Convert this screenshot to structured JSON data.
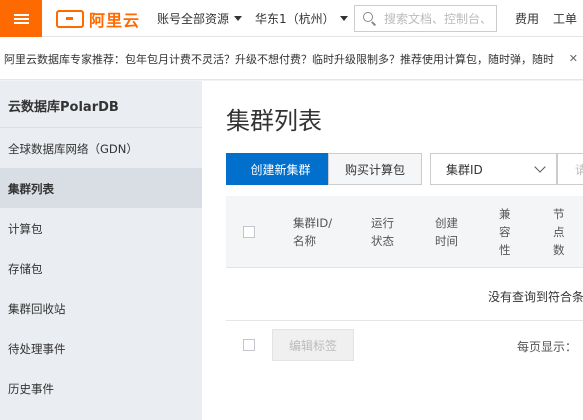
{
  "header": {
    "logo_text": "阿里云",
    "nav": {
      "resources": "账号全部资源",
      "region": "华东1（杭州）",
      "fees": "费用",
      "tickets": "工单"
    },
    "search": {
      "placeholder": "搜索文档、控制台、"
    }
  },
  "banner": {
    "text": "阿里云数据库专家推荐：包年包月计费不灵活？升级不想付费？临时升级限制多？推荐使用计算包，随时弹，随时",
    "close": "✕"
  },
  "sidebar": {
    "title": "云数据库PolarDB",
    "items": [
      {
        "label": "全球数据库网络（GDN）"
      },
      {
        "label": "集群列表",
        "active": true
      },
      {
        "label": "计算包"
      },
      {
        "label": "存储包"
      },
      {
        "label": "集群回收站"
      },
      {
        "label": "待处理事件"
      },
      {
        "label": "历史事件"
      }
    ]
  },
  "main": {
    "title": "集群列表",
    "create_button": "创建新集群",
    "buy_button": "购买计算包",
    "filter_select": "集群ID",
    "filter_input_placeholder": "请",
    "columns": [
      [
        "集群ID/",
        "名称"
      ],
      [
        "运行",
        "状态"
      ],
      [
        "创建",
        "时间"
      ],
      [
        "兼",
        "容",
        "性"
      ],
      [
        "节",
        "点",
        "数"
      ]
    ],
    "empty_text": "没有查询到符合条",
    "edit_tags_button": "编辑标签",
    "per_page_label": "每页显示："
  },
  "colors": {
    "accent": "#ff6a00",
    "primary": "#0070cc"
  }
}
